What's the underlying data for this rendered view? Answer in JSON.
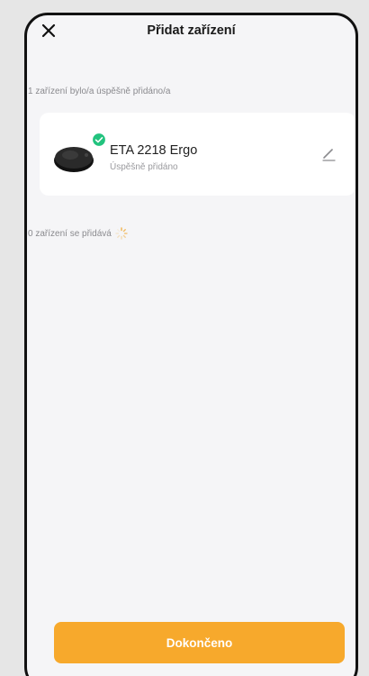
{
  "header": {
    "title": "Přidat zařízení",
    "close_icon": "close-icon"
  },
  "added_section": {
    "label": "1 zařízení bylo/a úspěšně přidáno/a"
  },
  "device_card": {
    "name": "ETA 2218 Ergo",
    "status": "Úspěšně přidáno",
    "image_icon": "robot-vacuum-icon",
    "badge_icon": "check-badge-icon",
    "edit_icon": "pencil-icon"
  },
  "adding_section": {
    "label": "0 zařízení se přidává",
    "spinner_icon": "loading-spinner-icon"
  },
  "footer": {
    "done_label": "Dokončeno"
  },
  "colors": {
    "accent": "#f7a92c",
    "success": "#22c37e",
    "background": "#f5f5f7",
    "card": "#ffffff"
  }
}
